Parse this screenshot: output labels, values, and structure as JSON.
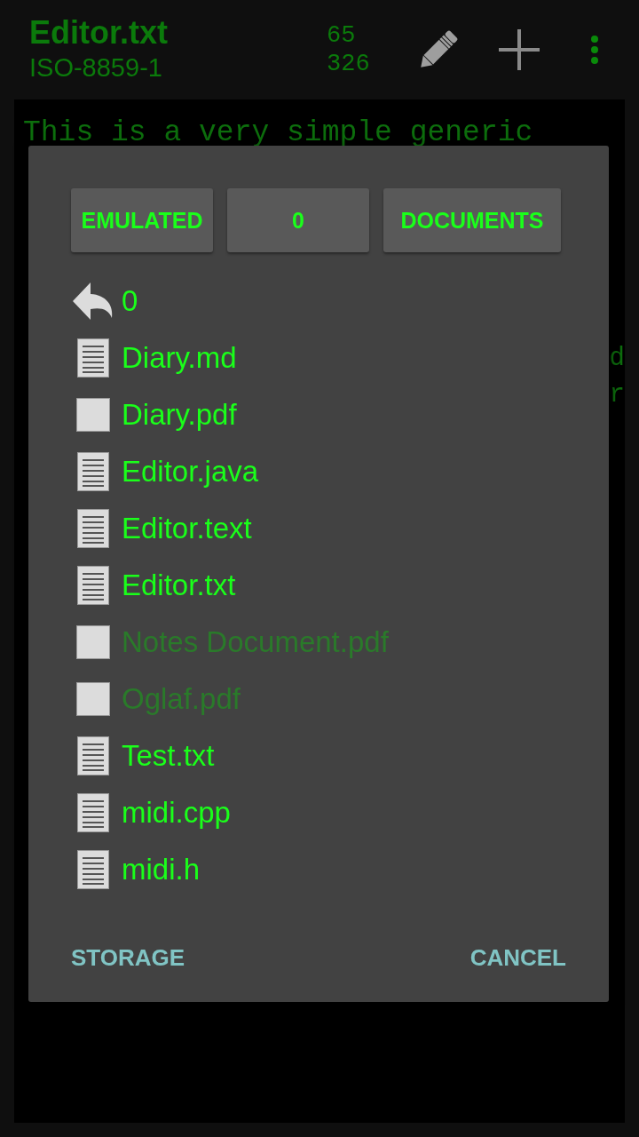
{
  "toolbar": {
    "title": "Editor.txt",
    "subtitle": "ISO-8859-1",
    "counts": [
      "65",
      "326"
    ]
  },
  "editor": {
    "first_line": "This is a very simple generic",
    "right_edge": [
      "d",
      "r"
    ]
  },
  "dialog": {
    "path_buttons": [
      "EMULATED",
      "0",
      "DOCUMENTS"
    ],
    "items": [
      {
        "kind": "up",
        "name": "0",
        "disabled": false
      },
      {
        "kind": "text",
        "name": "Diary.md",
        "disabled": false
      },
      {
        "kind": "blank",
        "name": "Diary.pdf",
        "disabled": false
      },
      {
        "kind": "text",
        "name": "Editor.java",
        "disabled": false
      },
      {
        "kind": "text",
        "name": "Editor.text",
        "disabled": false
      },
      {
        "kind": "text",
        "name": "Editor.txt",
        "disabled": false
      },
      {
        "kind": "blank",
        "name": "Notes Document.pdf",
        "disabled": true
      },
      {
        "kind": "blank",
        "name": "Oglaf.pdf",
        "disabled": true
      },
      {
        "kind": "text",
        "name": "Test.txt",
        "disabled": false
      },
      {
        "kind": "text",
        "name": "midi.cpp",
        "disabled": false
      },
      {
        "kind": "text",
        "name": "midi.h",
        "disabled": false
      }
    ],
    "actions": [
      "STORAGE",
      "CANCEL"
    ]
  }
}
